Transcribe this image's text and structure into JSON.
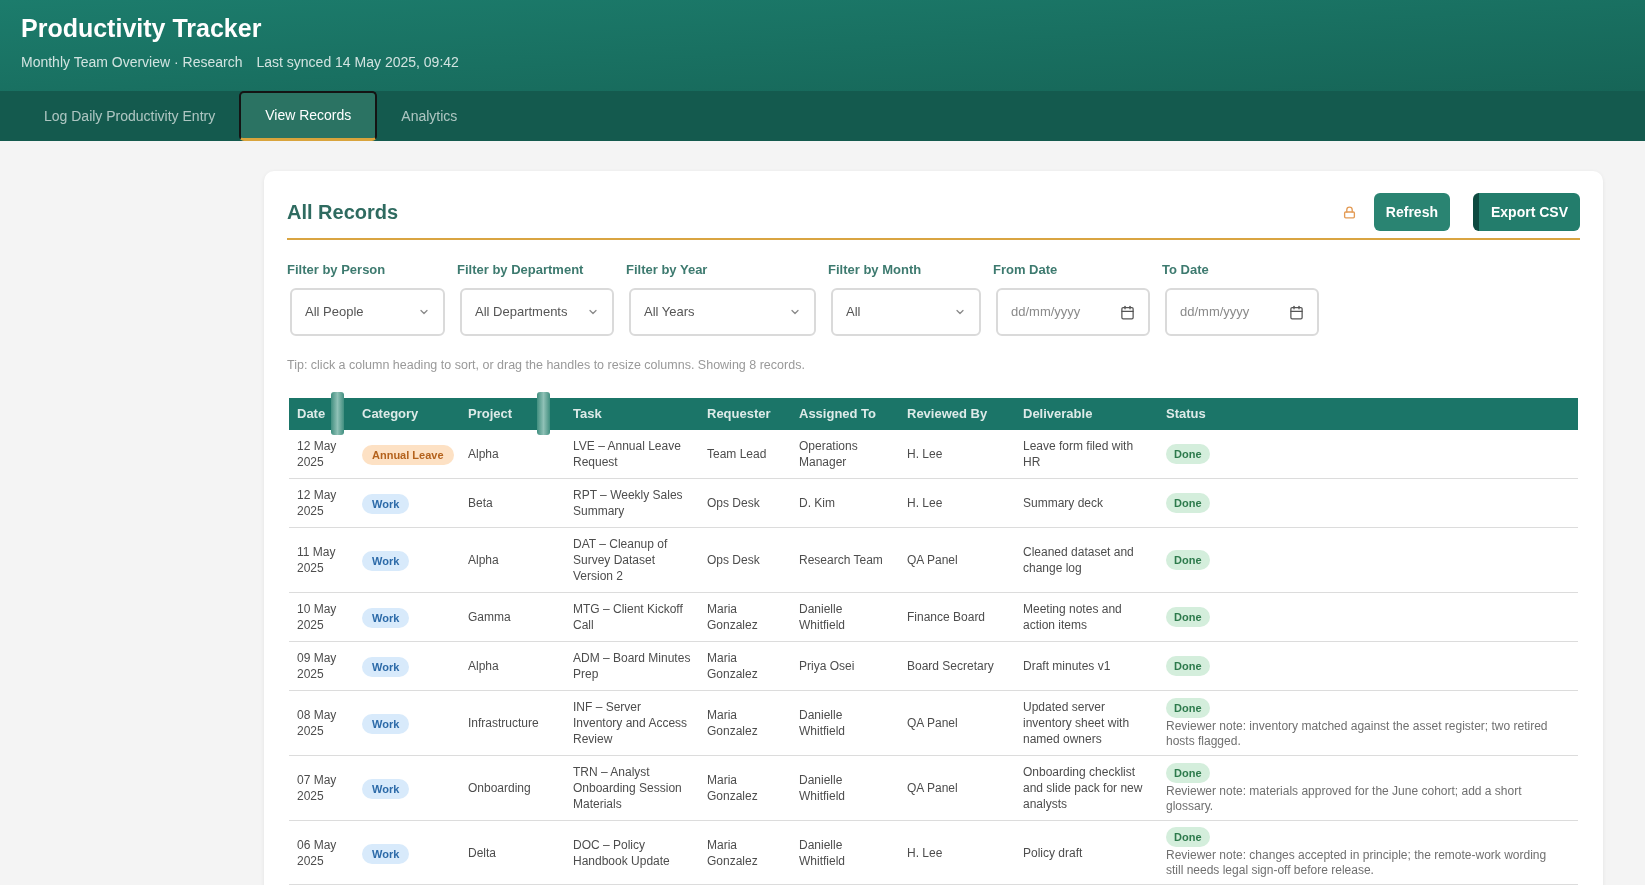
{
  "header": {
    "title": "Productivity Tracker",
    "subtitle": "Monthly Team Overview · Research",
    "updated": "Last synced 14 May 2025, 09:42"
  },
  "nav": [
    {
      "label": "Log Daily Productivity Entry",
      "selected": false
    },
    {
      "label": "View Records",
      "selected": true
    },
    {
      "label": "Analytics",
      "selected": false
    }
  ],
  "records": {
    "title": "All Records",
    "buttons": [
      "Refresh",
      "Export CSV"
    ],
    "filters": [
      {
        "label": "Filter by Person",
        "kind": "select",
        "value": "All People"
      },
      {
        "label": "Filter by Department",
        "kind": "select",
        "value": "All Departments"
      },
      {
        "label": "Filter by Year",
        "kind": "select",
        "value": "All Years"
      },
      {
        "label": "Filter by Month",
        "kind": "select",
        "value": "All"
      },
      {
        "label": "From Date",
        "kind": "date",
        "placeholder": "dd/mm/yyyy"
      },
      {
        "label": "To Date",
        "kind": "date",
        "placeholder": "dd/mm/yyyy"
      }
    ],
    "hint": "Tip: click a column heading to sort, or drag the handles to resize columns. Showing 8 records.",
    "table": {
      "columns": [
        "Date",
        "Category",
        "Project",
        "Task",
        "Requester",
        "Assigned To",
        "Reviewed By",
        "Deliverable",
        "Status"
      ],
      "rows": [
        {
          "date": "12 May 2025",
          "category": {
            "label": "Annual Leave",
            "kind": "leave"
          },
          "project": "Alpha",
          "task": "LVE – Annual Leave Request",
          "requested_by": "Team Lead",
          "assigned_to": "Operations Manager",
          "reviewed_by": "H. Lee",
          "deliverable": "Leave form filed with HR",
          "status": {
            "label": "Done",
            "kind": "done"
          }
        },
        {
          "date": "12 May 2025",
          "category": {
            "label": "Work",
            "kind": "work"
          },
          "project": "Beta",
          "task": "RPT – Weekly Sales Summary",
          "requested_by": "Ops Desk",
          "assigned_to": "D. Kim",
          "reviewed_by": "H. Lee",
          "deliverable": "Summary deck",
          "status": {
            "label": "Done",
            "kind": "done"
          }
        },
        {
          "date": "11 May 2025",
          "category": {
            "label": "Work",
            "kind": "work"
          },
          "project": "Alpha",
          "task": "DAT – Cleanup of Survey Dataset Version 2",
          "requested_by": "Ops Desk",
          "assigned_to": "Research Team",
          "reviewed_by": "QA Panel",
          "deliverable": "Cleaned dataset and change log",
          "status": {
            "label": "Done",
            "kind": "done"
          }
        },
        {
          "date": "10 May 2025",
          "category": {
            "label": "Work",
            "kind": "work"
          },
          "project": "Gamma",
          "task": "MTG – Client Kickoff Call",
          "requested_by": "Maria Gonzalez",
          "assigned_to": "Danielle Whitfield",
          "reviewed_by": "Finance Board",
          "deliverable": "Meeting notes and action items",
          "status": {
            "label": "Done",
            "kind": "done"
          }
        },
        {
          "date": "09 May 2025",
          "category": {
            "label": "Work",
            "kind": "work"
          },
          "project": "Alpha",
          "task": "ADM – Board Minutes Prep",
          "requested_by": "Maria Gonzalez",
          "assigned_to": "Priya Osei",
          "reviewed_by": "Board Secretary",
          "deliverable": "Draft minutes v1",
          "status": {
            "label": "Done",
            "kind": "done"
          }
        },
        {
          "date": "08 May 2025",
          "category": {
            "label": "Work",
            "kind": "work"
          },
          "project": "Infrastructure",
          "task": "INF – Server Inventory and Access Review",
          "requested_by": "Maria Gonzalez",
          "assigned_to": "Danielle Whitfield",
          "reviewed_by": "QA Panel",
          "deliverable": "Updated server inventory sheet with named owners",
          "status": {
            "label": "Done",
            "kind": "done"
          },
          "comment": "Reviewer note: inventory matched against the asset register; two retired hosts flagged."
        },
        {
          "date": "07 May 2025",
          "category": {
            "label": "Work",
            "kind": "work"
          },
          "project": "Onboarding",
          "task": "TRN – Analyst Onboarding Session Materials",
          "requested_by": "Maria Gonzalez",
          "assigned_to": "Danielle Whitfield",
          "reviewed_by": "QA Panel",
          "deliverable": "Onboarding checklist and slide pack for new analysts",
          "status": {
            "label": "Done",
            "kind": "done"
          },
          "comment": "Reviewer note: materials approved for the June cohort; add a short glossary."
        },
        {
          "date": "06 May 2025",
          "category": {
            "label": "Work",
            "kind": "work"
          },
          "project": "Delta",
          "task": "DOC – Policy Handbook Update",
          "requested_by": "Maria Gonzalez",
          "assigned_to": "Danielle Whitfield",
          "reviewed_by": "H. Lee",
          "deliverable": "Policy draft",
          "status": {
            "label": "Done",
            "kind": "done"
          },
          "comment": "Reviewer note: changes accepted in principle; the remote-work wording still needs legal sign-off before release."
        }
      ]
    }
  }
}
